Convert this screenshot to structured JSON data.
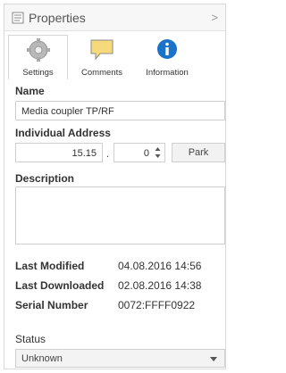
{
  "header": {
    "title": "Properties",
    "collapse_glyph": ">"
  },
  "tabs": [
    {
      "label": "Settings",
      "icon": "gear-icon"
    },
    {
      "label": "Comments",
      "icon": "comment-icon"
    },
    {
      "label": "Information",
      "icon": "info-icon"
    }
  ],
  "name": {
    "label": "Name",
    "value": "Media coupler TP/RF"
  },
  "address": {
    "label": "Individual Address",
    "value": "15.15",
    "separator": ".",
    "device": "0",
    "park_label": "Park"
  },
  "description": {
    "label": "Description",
    "value": ""
  },
  "info": {
    "last_modified_label": "Last Modified",
    "last_modified_value": "04.08.2016 14:56",
    "last_downloaded_label": "Last Downloaded",
    "last_downloaded_value": "02.08.2016 14:38",
    "serial_label": "Serial Number",
    "serial_value": "0072:FFFF0922"
  },
  "status": {
    "label": "Status",
    "value": "Unknown"
  },
  "colors": {
    "info_blue": "#1a73c9",
    "comment_yellow": "#f6d97a"
  }
}
